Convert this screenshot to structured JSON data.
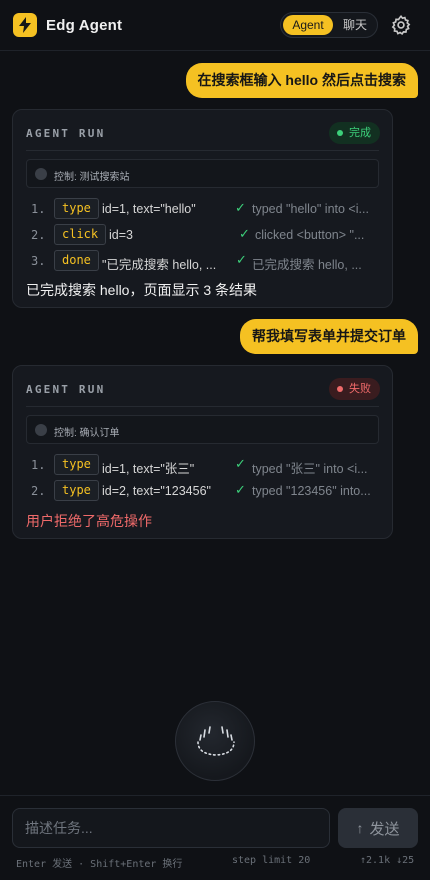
{
  "header": {
    "title": "Edg Agent",
    "mode_agent": "Agent",
    "mode_chat": "聊天",
    "logo_icon": "lightning-bolt-icon",
    "settings_icon": "gear-icon"
  },
  "messages": [
    {
      "user": "在搜索框输入 hello 然后点击搜索",
      "run": {
        "label": "AGENT RUN",
        "status": "完成",
        "control": "控制: 测试搜索站",
        "steps": [
          {
            "num": "1.",
            "action": "type",
            "args": "id=1, text=\"hello\"",
            "check": "✓",
            "result": "typed \"hello\" into <i..."
          },
          {
            "num": "2.",
            "action": "click",
            "args": "id=3",
            "check": "✓",
            "result": "clicked <button> \"..."
          },
          {
            "num": "3.",
            "action": "done",
            "args": "\"已完成搜索 hello, ...",
            "check": "✓",
            "result": "已完成搜索 hello, ..."
          }
        ],
        "summary": "已完成搜索 hello，页面显示 3 条结果"
      }
    },
    {
      "user": "帮我填写表单并提交订单",
      "run": {
        "label": "AGENT RUN",
        "status": "失败",
        "control": "控制: 确认订单",
        "steps": [
          {
            "num": "1.",
            "action": "type",
            "args": "id=1, text=\"张三\"",
            "check": "✓",
            "result": "typed \"张三\" into <i..."
          },
          {
            "num": "2.",
            "action": "type",
            "args": "id=2, text=\"123456\"",
            "check": "✓",
            "result": "typed \"123456\" into..."
          }
        ],
        "summary": "用户拒绝了高危操作"
      }
    }
  ],
  "composer": {
    "placeholder": "描述任务...",
    "send_label": "发送",
    "hint_keys": "Enter 发送 · Shift+Enter 换行",
    "hint_steps": "step limit 20",
    "hint_tokens": "↑2.1k ↓25"
  },
  "colors": {
    "accent": "#f5c122",
    "success": "#3ccf7a",
    "error": "#ef6a6a",
    "background": "#0f1115"
  }
}
